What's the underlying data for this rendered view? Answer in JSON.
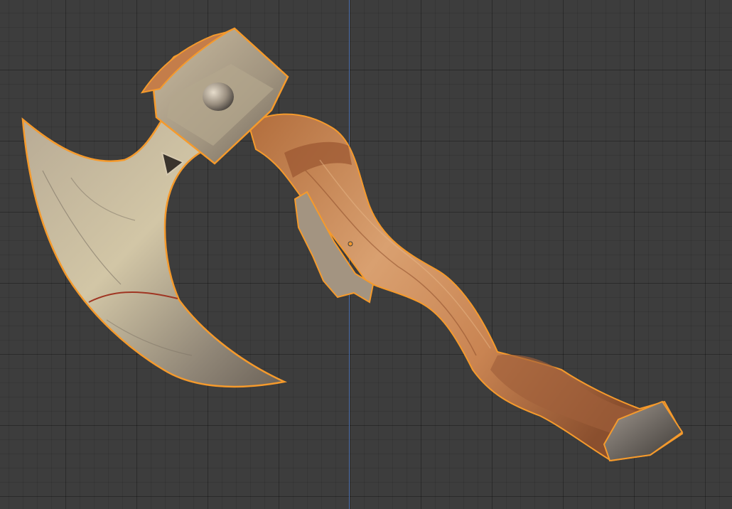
{
  "viewport": {
    "mode": "3d-viewport",
    "selection_outline_color": "#f59a2c",
    "y_axis_color": "#4f73b0",
    "grid_color": "#3d3d3d"
  },
  "object": {
    "name": "axe-model",
    "selected": true,
    "parts": [
      "axe-blade",
      "axe-head-block",
      "axe-handle",
      "handle-end-cap"
    ]
  }
}
